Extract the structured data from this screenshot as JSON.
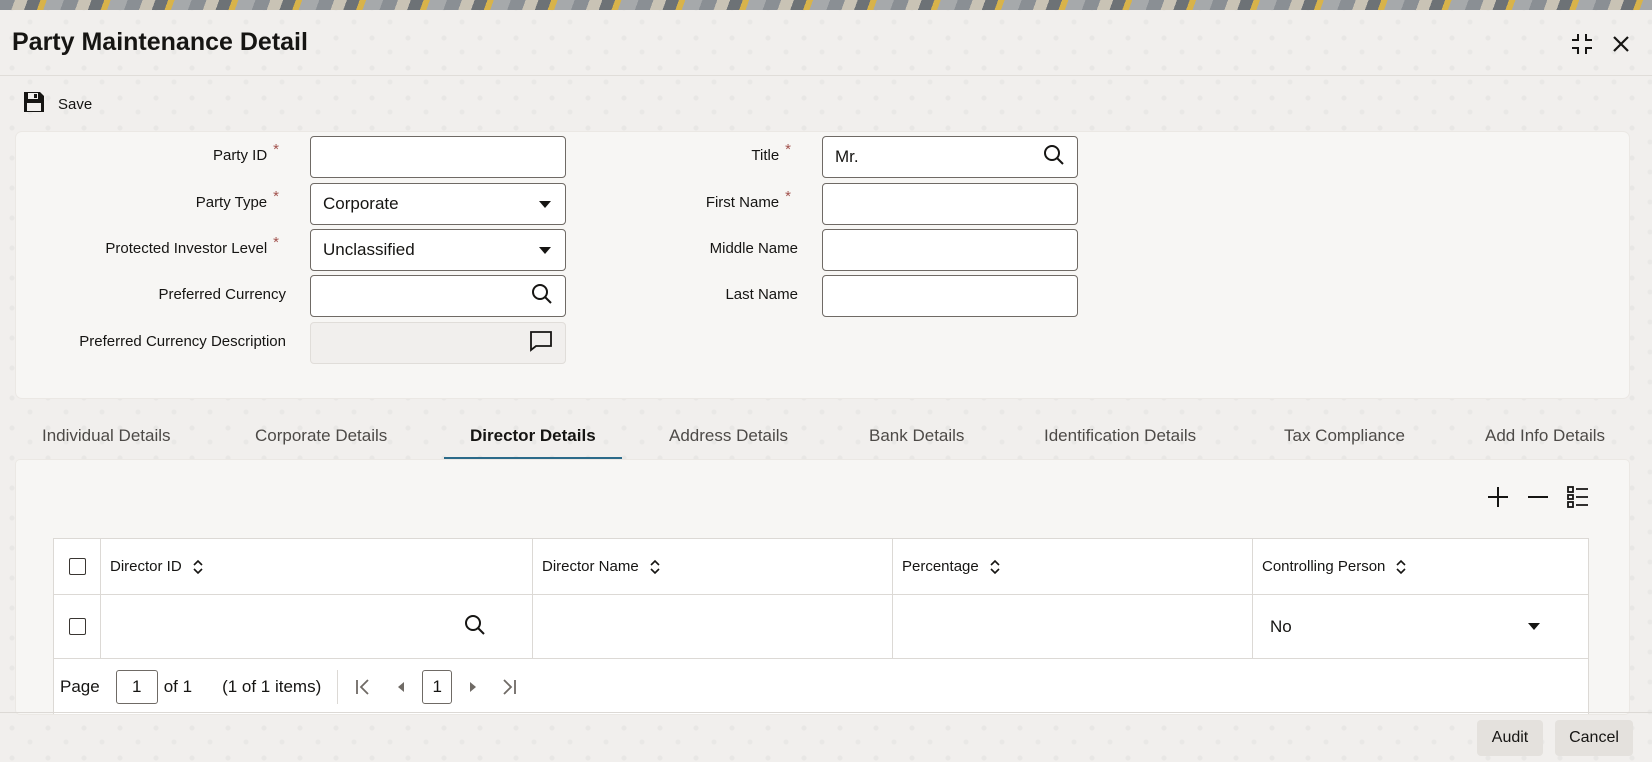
{
  "window": {
    "title": "Party Maintenance Detail"
  },
  "toolbar": {
    "save_label": "Save"
  },
  "form": {
    "party_id": {
      "label": "Party ID",
      "value": ""
    },
    "party_type": {
      "label": "Party Type",
      "value": "Corporate"
    },
    "protected_investor_level": {
      "label": "Protected Investor Level",
      "value": "Unclassified"
    },
    "preferred_currency": {
      "label": "Preferred Currency",
      "value": ""
    },
    "preferred_currency_description": {
      "label": "Preferred Currency Description",
      "value": ""
    },
    "title": {
      "label": "Title",
      "value": "Mr."
    },
    "first_name": {
      "label": "First Name",
      "value": ""
    },
    "middle_name": {
      "label": "Middle Name",
      "value": ""
    },
    "last_name": {
      "label": "Last Name",
      "value": ""
    },
    "required_mark": "*"
  },
  "tabs": [
    {
      "label": "Individual Details"
    },
    {
      "label": "Corporate Details"
    },
    {
      "label": "Director Details"
    },
    {
      "label": "Address Details"
    },
    {
      "label": "Bank Details"
    },
    {
      "label": "Identification Details"
    },
    {
      "label": "Tax Compliance"
    },
    {
      "label": "Add Info Details"
    }
  ],
  "active_tab": "Director Details",
  "grid": {
    "columns": [
      "Director ID",
      "Director Name",
      "Percentage",
      "Controlling Person"
    ],
    "rows": [
      {
        "director_id": "",
        "director_name": "",
        "percentage": "",
        "controlling_person": "No"
      }
    ]
  },
  "pager": {
    "page_label": "Page",
    "current_page": "1",
    "of_label": "of 1",
    "items_label": "(1 of 1 items)",
    "page_button": "1"
  },
  "footer": {
    "audit_label": "Audit",
    "cancel_label": "Cancel"
  },
  "colors": {
    "accent": "#2b6a89",
    "required": "#a2524d",
    "text": "#161513"
  }
}
